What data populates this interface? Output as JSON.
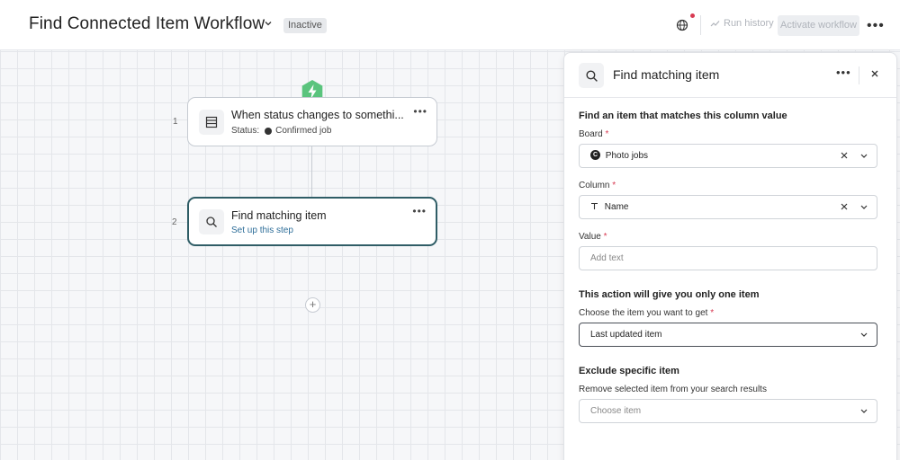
{
  "header": {
    "title": "Find Connected Item Workflow",
    "status": "Inactive",
    "run_history": "Run history",
    "activate": "Activate workflow"
  },
  "steps": [
    {
      "number": "1",
      "title": "When status changes to somethi...",
      "status_label": "Status:",
      "status_value": "Confirmed job",
      "icon": "table-icon"
    },
    {
      "number": "2",
      "title": "Find matching item",
      "subtitle": "Set up this step",
      "icon": "search-icon"
    }
  ],
  "panel": {
    "title": "Find matching item",
    "section1_title": "Find an item that matches this column value",
    "board_label": "Board",
    "board_value": "Photo jobs",
    "board_badge": "C",
    "column_label": "Column",
    "column_value": "Name",
    "value_label": "Value",
    "value_placeholder": "Add text",
    "section2_title": "This action will give you only one item",
    "choose_label": "Choose the item you want to get",
    "choose_value": "Last updated item",
    "section3_title": "Exclude specific item",
    "exclude_label": "Remove selected item from your search results",
    "exclude_placeholder": "Choose item",
    "required_mark": "*"
  },
  "colors": {
    "bolt": "#5ac47d",
    "selected_border": "#2f5d66",
    "link": "#2e6e99",
    "required": "#d83a52"
  }
}
